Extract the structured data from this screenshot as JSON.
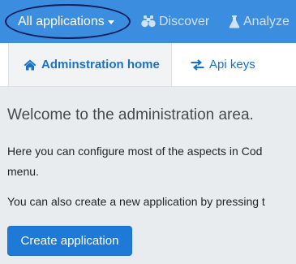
{
  "topnav": {
    "app_selector_label": "All applications",
    "discover_label": "Discover",
    "analyze_label": "Analyze"
  },
  "subnav": {
    "home_label": "Adminstration home",
    "apikeys_label": "Api keys"
  },
  "main": {
    "welcome": "Welcome to the administration area.",
    "para1_line1": "Here you can configure most of the aspects in Cod",
    "para1_line2": "menu.",
    "para2": "You can also create a new application by pressing t",
    "create_button": "Create application"
  },
  "colors": {
    "topbar": "#3b8de0",
    "accent": "#1a72c8",
    "button": "#1e7ad6",
    "background": "#e9ecef"
  },
  "icons": [
    "chevron-down-icon",
    "binoculars-icon",
    "flask-icon",
    "home-icon",
    "exchange-arrows-icon"
  ]
}
